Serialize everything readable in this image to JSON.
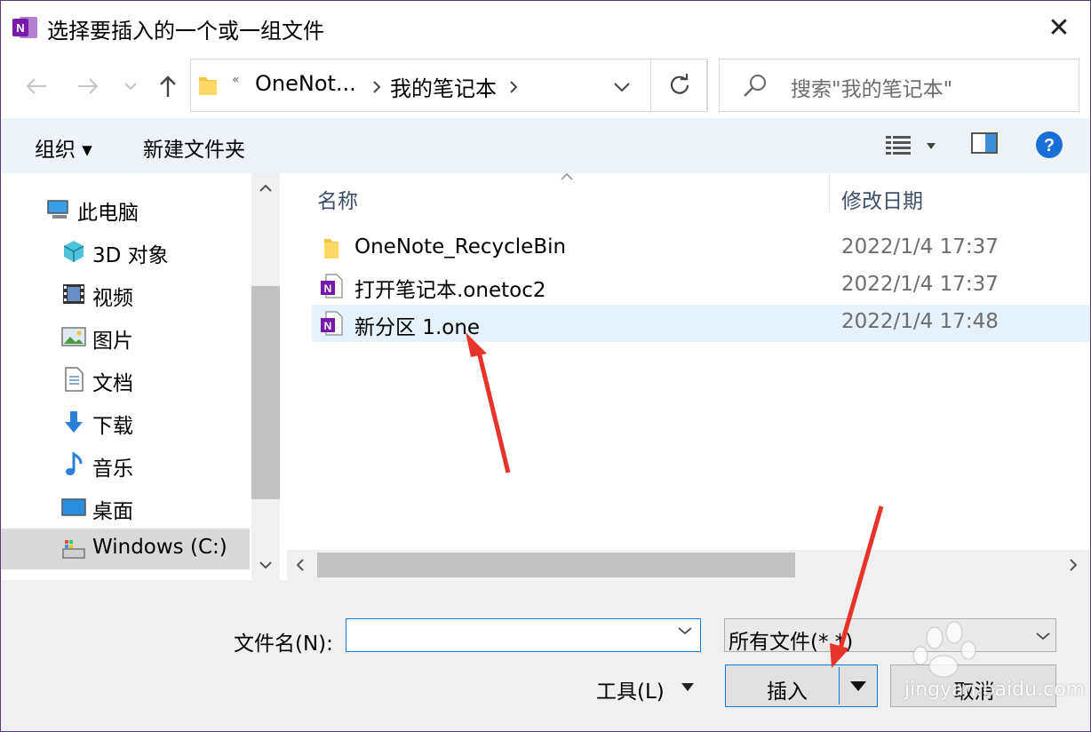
{
  "window": {
    "title": "选择要插入的一个或一组文件",
    "close_glyph": "✕"
  },
  "address": {
    "overflow": "«",
    "crumbs": [
      "OneNot...",
      "我的笔记本"
    ],
    "search_placeholder": "搜索\"我的笔记本\""
  },
  "toolbar": {
    "organize_label": "组织 ▾",
    "new_folder_label": "新建文件夹"
  },
  "nav_tree": {
    "items": [
      {
        "label": "此电脑",
        "icon": "computer-icon"
      },
      {
        "label": "3D 对象",
        "icon": "3d-objects-icon"
      },
      {
        "label": "视频",
        "icon": "video-icon"
      },
      {
        "label": "图片",
        "icon": "pictures-icon"
      },
      {
        "label": "文档",
        "icon": "documents-icon"
      },
      {
        "label": "下载",
        "icon": "download-icon"
      },
      {
        "label": "音乐",
        "icon": "music-icon"
      },
      {
        "label": "桌面",
        "icon": "desktop-icon"
      },
      {
        "label": "Windows (C:)",
        "icon": "drive-icon"
      }
    ]
  },
  "file_list": {
    "columns": {
      "name": "名称",
      "modified": "修改日期"
    },
    "rows": [
      {
        "name": "OneNote_RecycleBin",
        "modified": "2022/1/4 17:37",
        "icon": "folder-icon"
      },
      {
        "name": "打开笔记本.onetoc2",
        "modified": "2022/1/4 17:37",
        "icon": "onenote-file-icon"
      },
      {
        "name": "新分区 1.one",
        "modified": "2022/1/4 17:48",
        "icon": "onenote-file-icon",
        "selected": true
      }
    ]
  },
  "bottom": {
    "filename_label": "文件名(N):",
    "filename_value": "",
    "filetype_value": "所有文件(*.*)",
    "tools_label": "工具(L)",
    "insert_label": "插入",
    "cancel_label": "取消"
  },
  "watermark": {
    "text": "jingyan.baidu.com"
  },
  "colors": {
    "accent": "#0078d7",
    "onenote_purple": "#7719aa",
    "selection": "#e5f1fb",
    "annotation_arrow": "#e8332a"
  }
}
